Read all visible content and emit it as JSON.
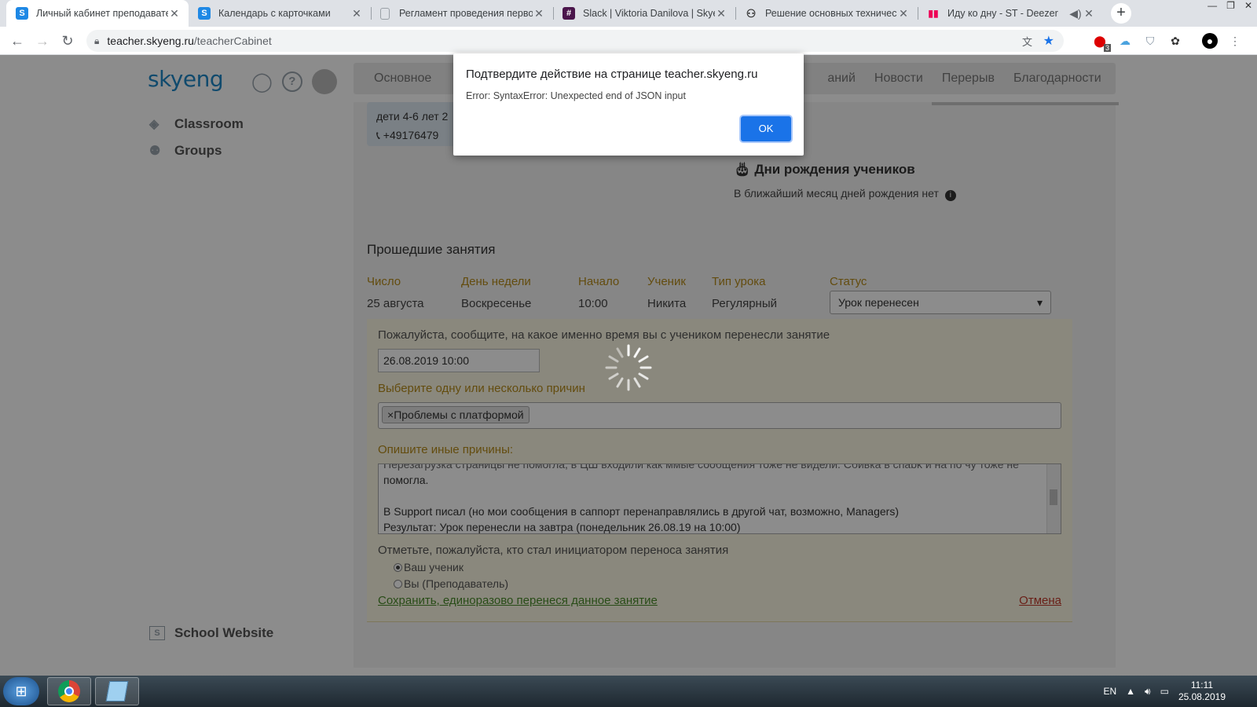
{
  "browser": {
    "tabs": [
      {
        "title": "Личный кабинет преподавате",
        "favicon": "S",
        "fav_color": "#1e88e5"
      },
      {
        "title": "Календарь с карточками",
        "favicon": "S",
        "fav_color": "#1e88e5"
      },
      {
        "title": "Регламент проведения перво",
        "favicon": "doc-icon",
        "fav_color": "#ffffff"
      },
      {
        "title": "Slack | Viktoria Danilova | Skyen",
        "favicon": "#",
        "fav_color": "#4a154b"
      },
      {
        "title": "Решение основных техническ",
        "favicon": "person-icon",
        "fav_color": "#ffffff"
      },
      {
        "title": "Иду ко дну - ST - Deezer",
        "favicon": "bars-icon",
        "fav_color": "#ffffff"
      }
    ],
    "url_host": "teacher.skyeng.ru",
    "url_path": "/teacherCabinet",
    "ext_badge": "3"
  },
  "site": {
    "logo_a": "sky",
    "logo_b": "eng",
    "nav": [
      "Основное",
      "аний",
      "Новости",
      "Перерыв",
      "Благодарности"
    ],
    "side": [
      "Classroom",
      "Groups"
    ],
    "school": "School Website"
  },
  "card": {
    "line1": "дети 4-6 лет 2",
    "line2": "+49176479"
  },
  "birthdays": {
    "title": "Дни рождения учеников",
    "subtitle": "В ближайший месяц дней рождения нет"
  },
  "past": {
    "title": "Прошедшие занятия",
    "headers": [
      "Число",
      "День недели",
      "Начало",
      "Ученик",
      "Тип урока",
      "Статус"
    ],
    "row": [
      "25 августа",
      "Воскресенье",
      "10:00",
      "Никита",
      "Регулярный"
    ],
    "status": "Урок перенесен"
  },
  "form": {
    "q1": "Пожалуйста, сообщите, на какое именно время вы с учеником перенесли занятие",
    "date": "26.08.2019 10:00",
    "q2": "Выберите одну или несколько причин",
    "tag": "Проблемы с платформой",
    "q3": "Опишите иные причины:",
    "text_l1": "Перезагрузка страницы не помогла, в ЦШ входили как ммые сообщения тоже не видели. Сбивка в chabk и на по чу тоже не",
    "text_l2": "помогла.",
    "text_l3": "",
    "text_l4": "В Support писал (но мои сообщения в саппорт перенаправлялись в другой чат, возможно, Managers)",
    "text_l5": "Результат: Урок перенесли на завтра (понедельник 26.08.19 на 10:00)",
    "q4": "Отметьте, пожалуйста, кто стал инициатором переноса занятия",
    "opt1": "Ваш ученик",
    "opt2": "Вы (Преподаватель)",
    "save": "Сохранить, единоразово перенеся данное занятие",
    "cancel": "Отмена"
  },
  "dialog": {
    "title": "Подтвердите действие на странице teacher.skyeng.ru",
    "message": "Error: SyntaxError: Unexpected end of JSON input",
    "ok": "OK"
  },
  "taskbar": {
    "lang": "EN",
    "time": "11:11",
    "date": "25.08.2019"
  }
}
